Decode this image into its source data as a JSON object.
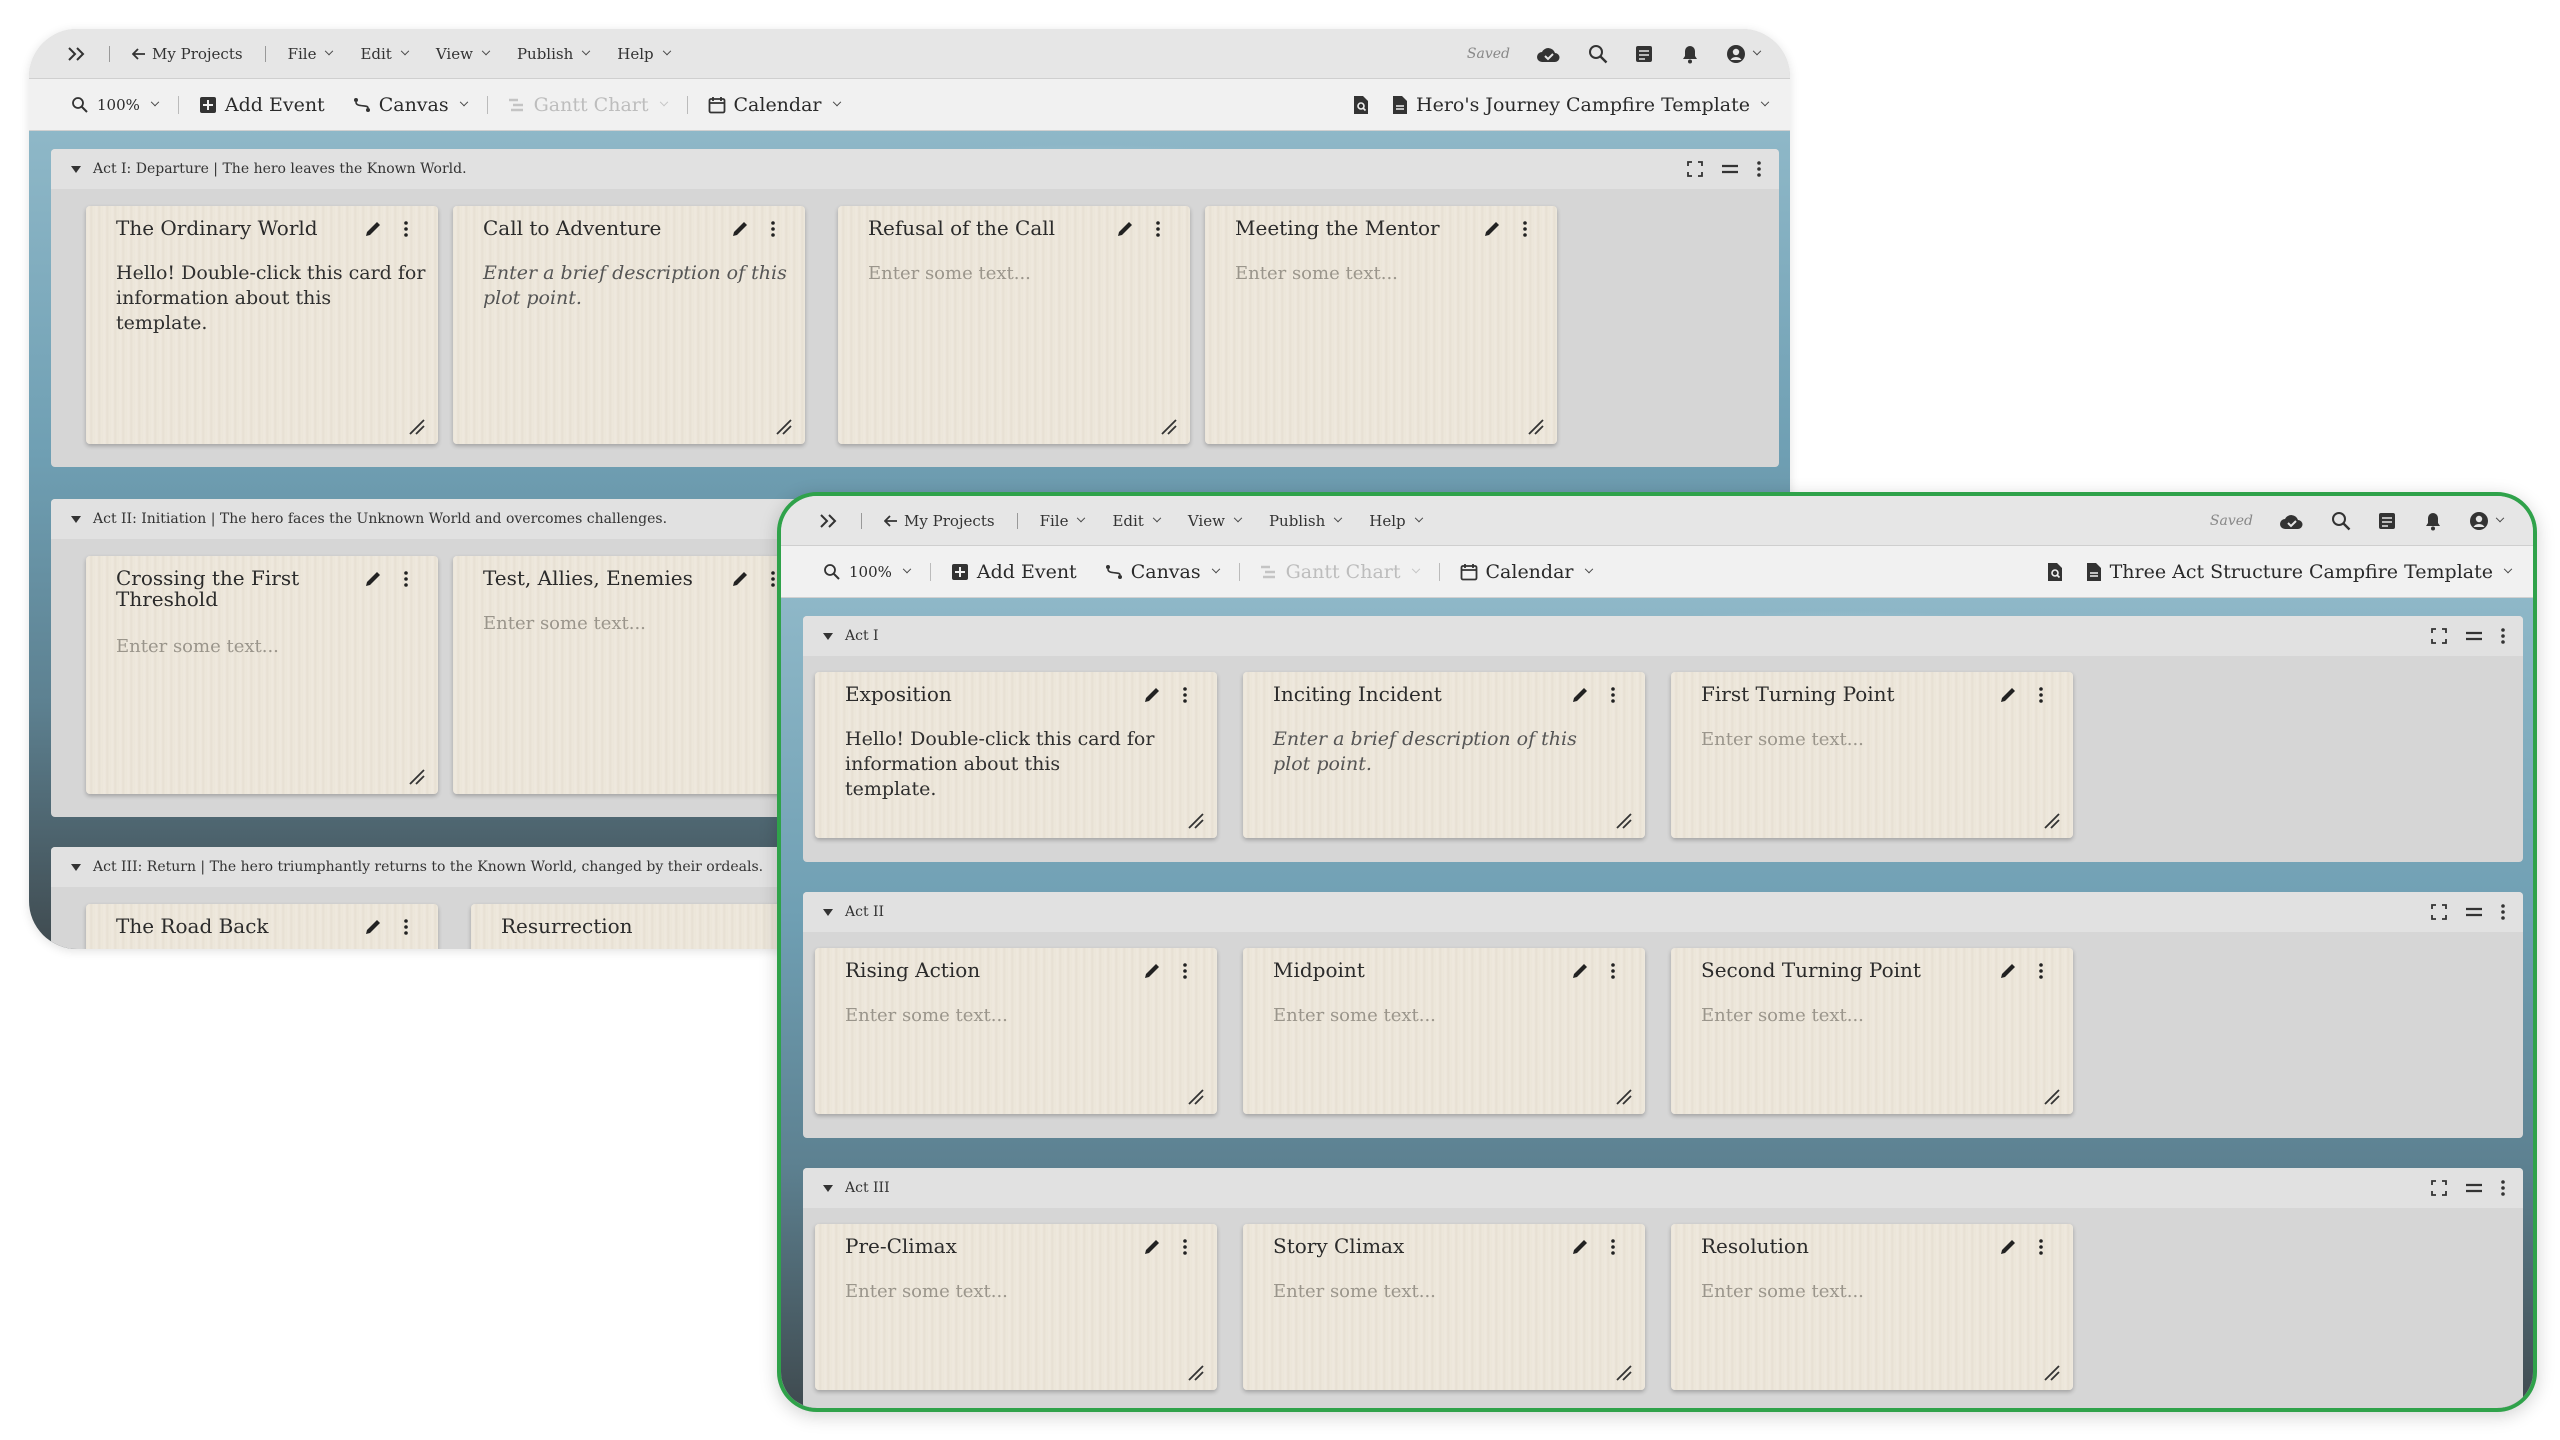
{
  "back_window": {
    "menubar": {
      "my_projects": "My Projects",
      "menus": [
        "File",
        "Edit",
        "View",
        "Publish",
        "Help"
      ],
      "saved": "Saved"
    },
    "toolbar": {
      "zoom": "100%",
      "add_event": "Add Event",
      "canvas": "Canvas",
      "gantt": "Gantt Chart",
      "calendar": "Calendar",
      "template": "Hero's Journey Campfire Template"
    },
    "sections": [
      {
        "title": "Act I: Departure | The hero leaves the Known World.",
        "cards": [
          {
            "title": "The Ordinary World",
            "body": "Hello! Double-click this card for information about this template."
          },
          {
            "title": "Call to Adventure",
            "body": "Enter a brief description of this plot point."
          },
          {
            "title": "Refusal of the Call",
            "body": "Enter some text..."
          },
          {
            "title": "Meeting the Mentor",
            "body": "Enter some text..."
          }
        ]
      },
      {
        "title": "Act II: Initiation | The hero faces the Unknown World and overcomes challenges.",
        "cards": [
          {
            "title": "Crossing the First Threshold",
            "body": "Enter some text..."
          },
          {
            "title": "Test, Allies, Enemies",
            "body": "Enter some text..."
          }
        ]
      },
      {
        "title": "Act III: Return | The hero triumphantly returns to the Known World, changed by their ordeals.",
        "cards": [
          {
            "title": "The Road Back"
          },
          {
            "title": "Resurrection"
          }
        ]
      }
    ]
  },
  "front_window": {
    "menubar": {
      "my_projects": "My Projects",
      "menus": [
        "File",
        "Edit",
        "View",
        "Publish",
        "Help"
      ],
      "saved": "Saved"
    },
    "toolbar": {
      "zoom": "100%",
      "add_event": "Add Event",
      "canvas": "Canvas",
      "gantt": "Gantt Chart",
      "calendar": "Calendar",
      "template": "Three Act Structure Campfire Template"
    },
    "sections": [
      {
        "title": "Act I",
        "cards": [
          {
            "title": "Exposition",
            "body": "Hello! Double-click this card for information about this template."
          },
          {
            "title": "Inciting Incident",
            "body": "Enter a brief description of this plot point."
          },
          {
            "title": "First Turning Point",
            "body": "Enter some text..."
          }
        ]
      },
      {
        "title": "Act II",
        "cards": [
          {
            "title": "Rising Action",
            "body": "Enter some text..."
          },
          {
            "title": "Midpoint",
            "body": "Enter some text..."
          },
          {
            "title": "Second Turning Point",
            "body": "Enter some text..."
          }
        ]
      },
      {
        "title": "Act III",
        "cards": [
          {
            "title": "Pre-Climax",
            "body": "Enter some text..."
          },
          {
            "title": "Story Climax",
            "body": "Enter some text..."
          },
          {
            "title": "Resolution",
            "body": "Enter some text..."
          }
        ]
      }
    ]
  }
}
